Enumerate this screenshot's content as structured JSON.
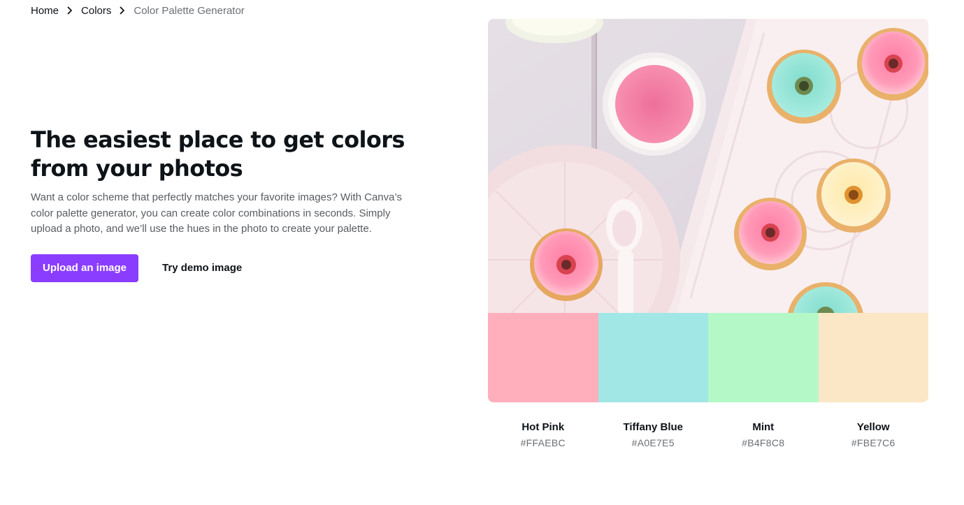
{
  "breadcrumb": {
    "items": [
      {
        "label": "Home"
      },
      {
        "label": "Colors"
      },
      {
        "label": "Color Palette Generator"
      }
    ]
  },
  "hero": {
    "title_line1": "The easiest place to get colors",
    "title_line2": "from your photos",
    "description": "Want a color scheme that perfectly matches your favorite images? With Canva’s color palette generator, you can create color combinations in seconds. Simply upload a photo, and we’ll use the hues in the photo to create your palette.",
    "upload_label": "Upload an image",
    "demo_label": "Try demo image"
  },
  "palette": [
    {
      "name": "Hot Pink",
      "hex": "#FFAEBC"
    },
    {
      "name": "Tiffany Blue",
      "hex": "#A0E7E5"
    },
    {
      "name": "Mint",
      "hex": "#B4F8C8"
    },
    {
      "name": "Yellow",
      "hex": "#FBE7C6"
    }
  ],
  "colors": {
    "primary_button": "#8b3dff",
    "text": "#0e1318",
    "muted_text": "#585c61"
  },
  "icons": {
    "breadcrumb_separator": "chevron-right-icon"
  }
}
